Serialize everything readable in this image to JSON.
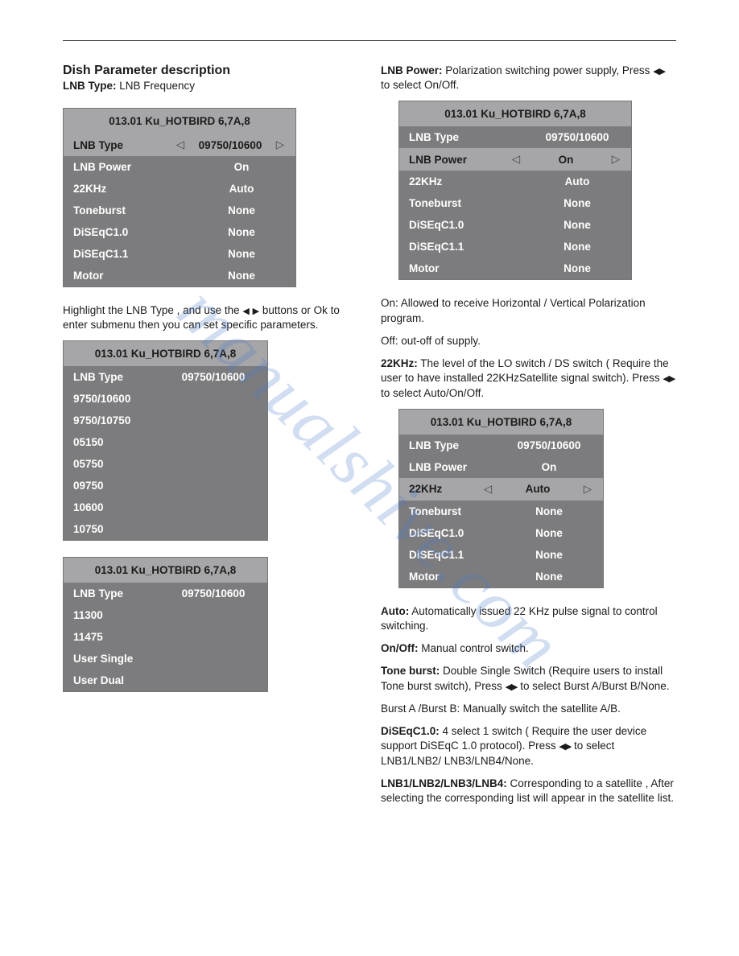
{
  "watermark": "manualshive.com",
  "left": {
    "heading": "Dish Parameter description",
    "sub_label": "LNB Type:",
    "sub_value": " LNB Frequency",
    "panel1": {
      "title": "013.01 Ku_HOTBIRD 6,7A,8",
      "rows": [
        {
          "label": "LNB Type",
          "value": "09750/10600",
          "selected": true
        },
        {
          "label": "LNB Power",
          "value": "On"
        },
        {
          "label": "22KHz",
          "value": "Auto"
        },
        {
          "label": "Toneburst",
          "value": "None"
        },
        {
          "label": "DiSEqC1.0",
          "value": "None"
        },
        {
          "label": "DiSEqC1.1",
          "value": "None"
        },
        {
          "label": "Motor",
          "value": "None"
        }
      ]
    },
    "note1a": "Highlight the LNB Type , and use the ",
    "note1b": " buttons or Ok to enter submenu then you can set specific parameters.",
    "panel2": {
      "title": "013.01 Ku_HOTBIRD 6,7A,8",
      "header": {
        "label": "LNB Type",
        "value": "09750/10600"
      },
      "items": [
        {
          "label": "9750/10600",
          "selected": true
        },
        {
          "label": "9750/10750"
        },
        {
          "label": "05150"
        },
        {
          "label": "05750"
        },
        {
          "label": "09750"
        },
        {
          "label": "10600"
        },
        {
          "label": "10750"
        }
      ]
    },
    "panel3": {
      "title": "013.01 Ku_HOTBIRD 6,7A,8",
      "header": {
        "label": "LNB Type",
        "value": "09750/10600"
      },
      "items": [
        {
          "label": "11300"
        },
        {
          "label": "11475"
        },
        {
          "label": "User Single",
          "selected": true
        },
        {
          "label": "User Dual"
        }
      ]
    }
  },
  "right": {
    "desc_label": "LNB Power:",
    "desc_a": " Polarization switching power supply, Press ",
    "desc_b": " to select On/Off.",
    "panel1": {
      "title": "013.01 Ku_HOTBIRD 6,7A,8",
      "rows": [
        {
          "label": "LNB Type",
          "value": "09750/10600"
        },
        {
          "label": "LNB Power",
          "value": "On",
          "selected": true
        },
        {
          "label": "22KHz",
          "value": "Auto"
        },
        {
          "label": "Toneburst",
          "value": "None"
        },
        {
          "label": "DiSEqC1.0",
          "value": "None"
        },
        {
          "label": "DiSEqC1.1",
          "value": "None"
        },
        {
          "label": "Motor",
          "value": "None"
        }
      ]
    },
    "on_text": "On: Allowed to receive Horizontal / Vertical Polarization program.",
    "off_text": "Off: out-off of supply.",
    "khz_label": "22KHz:",
    "khz_a": " The level of the LO switch / DS switch ( Require the user to have installed 22KHzSatellite signal switch).",
    "khz_b": " Press ",
    "khz_c": " to select Auto/On/Off.",
    "panel2": {
      "title": "013.01 Ku_HOTBIRD 6,7A,8",
      "rows": [
        {
          "label": "LNB Type",
          "value": "09750/10600"
        },
        {
          "label": "LNB Power",
          "value": "On"
        },
        {
          "label": "22KHz",
          "value": "Auto",
          "selected": true
        },
        {
          "label": "Toneburst",
          "value": "None"
        },
        {
          "label": "DiSEqC1.0",
          "value": "None"
        },
        {
          "label": "DiSEqC1.1",
          "value": "None"
        },
        {
          "label": "Motor",
          "value": "None"
        }
      ]
    },
    "auto_label": "Auto:",
    "auto_text": " Automatically issued 22 KHz pulse signal to control switching.",
    "onoff_label": "On/Off:",
    "onoff_text": " Manual control switch.",
    "tb_label": "Tone burst:",
    "tb_a": " Double Single Switch (Require users to install Tone burst switch), Press ",
    "tb_b": " to select Burst A/Burst B/None.",
    "burst_text": "Burst A /Burst B: Manually switch the satellite A/B.",
    "diseqc_label": "DiSEqC1.0:",
    "diseqc_a": " 4 select 1 switch ( Require the user device support DiSEqC 1.0 protocol). Press ",
    "diseqc_b": " to select LNB1/LNB2/ LNB3/LNB4/None.",
    "lnb_label": "LNB1/LNB2/LNB3/LNB4:",
    "lnb_text": " Corresponding to a satellite , After selecting the corresponding list will appear in the satellite list."
  }
}
